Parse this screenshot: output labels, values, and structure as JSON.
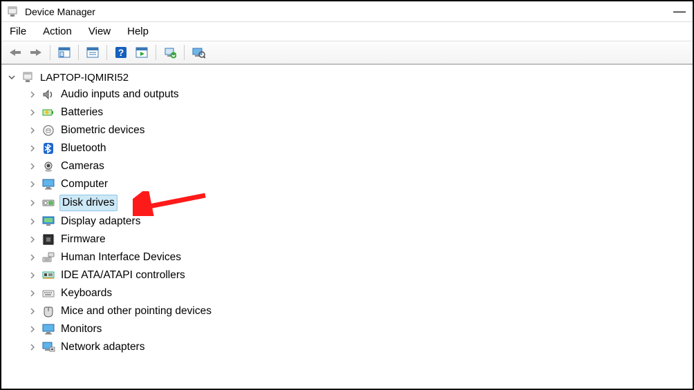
{
  "window": {
    "title": "Device Manager"
  },
  "menu": {
    "file": "File",
    "action": "Action",
    "view": "View",
    "help": "Help"
  },
  "root": {
    "name": "LAPTOP-IQMIRI52"
  },
  "categories": [
    {
      "label": "Audio inputs and outputs",
      "selected": false
    },
    {
      "label": "Batteries",
      "selected": false
    },
    {
      "label": "Biometric devices",
      "selected": false
    },
    {
      "label": "Bluetooth",
      "selected": false
    },
    {
      "label": "Cameras",
      "selected": false
    },
    {
      "label": "Computer",
      "selected": false
    },
    {
      "label": "Disk drives",
      "selected": true
    },
    {
      "label": "Display adapters",
      "selected": false
    },
    {
      "label": "Firmware",
      "selected": false
    },
    {
      "label": "Human Interface Devices",
      "selected": false
    },
    {
      "label": "IDE ATA/ATAPI controllers",
      "selected": false
    },
    {
      "label": "Keyboards",
      "selected": false
    },
    {
      "label": "Mice and other pointing devices",
      "selected": false
    },
    {
      "label": "Monitors",
      "selected": false
    },
    {
      "label": "Network adapters",
      "selected": false
    }
  ]
}
